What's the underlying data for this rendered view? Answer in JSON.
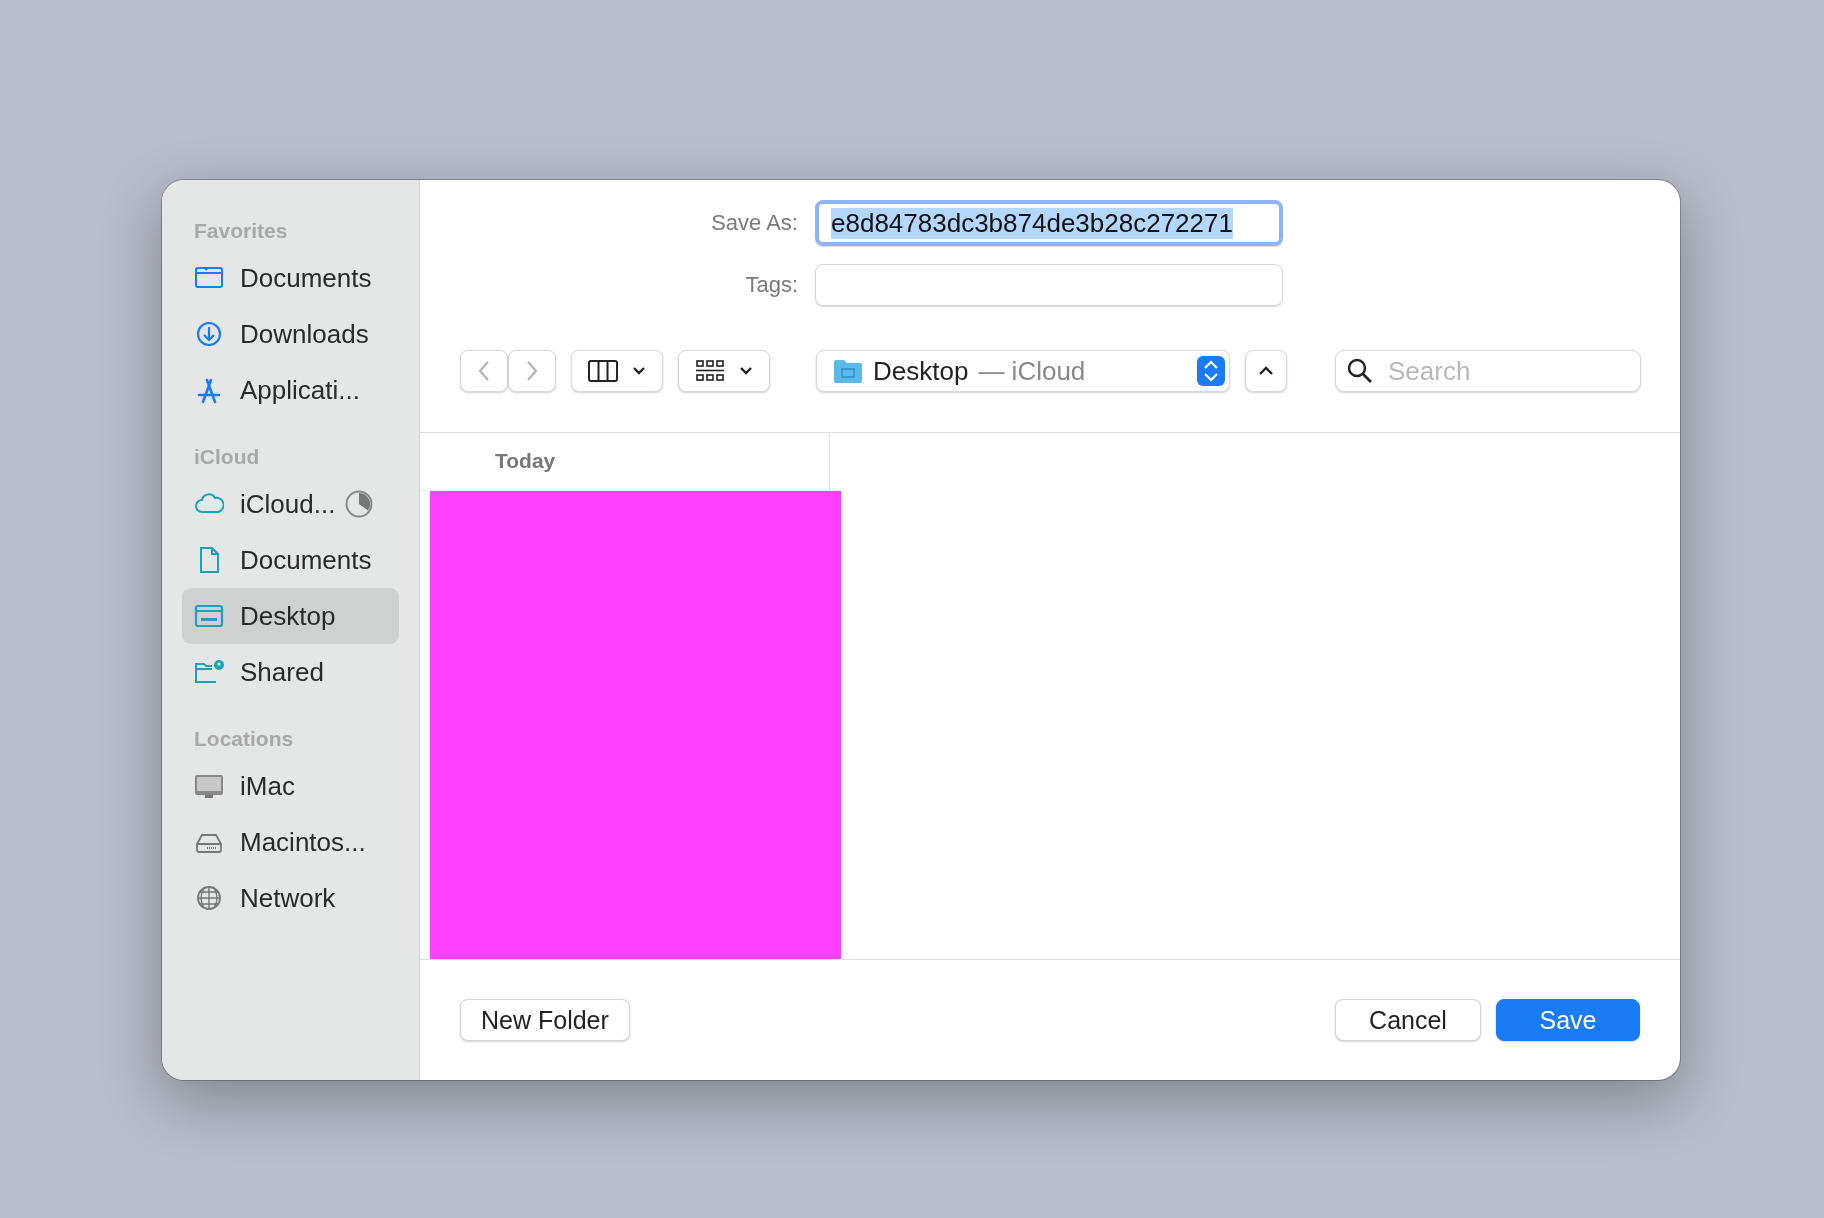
{
  "sidebar": {
    "sections": [
      {
        "title": "Favorites",
        "items": [
          {
            "label": "Documents",
            "kind": "folder",
            "selected": false
          },
          {
            "label": "Downloads",
            "kind": "download",
            "selected": false
          },
          {
            "label": "Applicati...",
            "kind": "apps",
            "selected": false
          }
        ]
      },
      {
        "title": "iCloud",
        "items": [
          {
            "label": "iCloud...",
            "kind": "cloud",
            "selected": false
          },
          {
            "label": "Documents",
            "kind": "document",
            "selected": false
          },
          {
            "label": "Desktop",
            "kind": "desktop",
            "selected": true
          },
          {
            "label": "Shared",
            "kind": "shared",
            "selected": false
          }
        ]
      },
      {
        "title": "Locations",
        "items": [
          {
            "label": "iMac",
            "kind": "imac",
            "selected": false
          },
          {
            "label": "Macintos...",
            "kind": "disk",
            "selected": false
          },
          {
            "label": "Network",
            "kind": "globe",
            "selected": false
          }
        ]
      }
    ]
  },
  "save_as": {
    "label": "Save As:",
    "value": "e8d84783dc3b874de3b28c272271",
    "focused": true,
    "text_selected": true
  },
  "tags": {
    "label": "Tags:"
  },
  "location": {
    "name": "Desktop",
    "suffix": "— iCloud"
  },
  "search": {
    "placeholder": "Search"
  },
  "browser": {
    "column": {
      "header": "Today",
      "items": [
        {
          "kind": "thumbnail",
          "color": "#ff40ff"
        }
      ]
    }
  },
  "buttons": [
    {
      "label": "New Folder",
      "kind": "secondary"
    },
    {
      "label": "Cancel",
      "kind": "secondary"
    },
    {
      "label": "Save",
      "kind": "default"
    }
  ]
}
